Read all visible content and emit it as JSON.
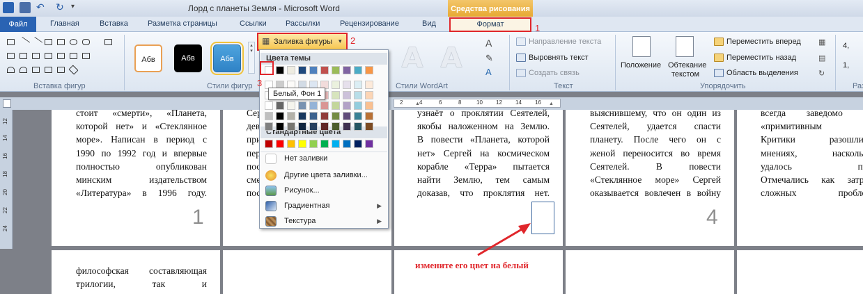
{
  "window": {
    "title": "Лорд с планеты Земля - Microsoft Word",
    "context_header": "Средства рисования"
  },
  "tabs": [
    {
      "label": "Файл"
    },
    {
      "label": "Главная"
    },
    {
      "label": "Вставка"
    },
    {
      "label": "Разметка страницы"
    },
    {
      "label": "Ссылки"
    },
    {
      "label": "Рассылки"
    },
    {
      "label": "Рецензирование"
    },
    {
      "label": "Вид"
    },
    {
      "label": "Формат"
    }
  ],
  "ribbon": {
    "groups": {
      "insert_shapes": "Вставка фигур",
      "shape_styles": "Стили фигур",
      "wordart_styles": "Стили WordArt",
      "text": "Текст",
      "arrange": "Упорядочить",
      "size_partial": "Разм"
    },
    "style_samples": [
      "Абв",
      "Абв",
      "Абв"
    ],
    "fill_button": "Заливка фигуры",
    "text_commands": {
      "direction": "Направление текста",
      "align": "Выровнять текст",
      "link": "Создать связь"
    },
    "arrange_commands": {
      "position": "Положение",
      "wrap_line1": "Обтекание",
      "wrap_line2": "текстом",
      "bring_forward": "Переместить вперед",
      "send_backward": "Переместить назад",
      "selection_pane": "Область выделения"
    },
    "size_partial": [
      "4,",
      "1,"
    ]
  },
  "dropdown": {
    "theme_colors_header": "Цвета темы",
    "standard_colors_header": "Стандартные цвета",
    "tooltip": "Белый, Фон 1",
    "theme_row": [
      "#ffffff",
      "#000000",
      "#eeece1",
      "#1f497d",
      "#4f81bd",
      "#c0504d",
      "#9bbb59",
      "#8064a2",
      "#4bacc6",
      "#f79646"
    ],
    "standard_row": [
      "#c00000",
      "#ff0000",
      "#ffc000",
      "#ffff00",
      "#92d050",
      "#00b050",
      "#00b0f0",
      "#0070c0",
      "#002060",
      "#7030a0"
    ],
    "items": {
      "no_fill": "Нет заливки",
      "more_colors": "Другие цвета заливки...",
      "picture": "Рисунок...",
      "gradient": "Градиентная",
      "texture": "Текстура"
    }
  },
  "annotations": {
    "marker1": "1",
    "marker2": "2",
    "marker3": "3",
    "instruction": "измените его цвет на белый"
  },
  "ruler": {
    "h_ticks": [
      "2",
      "4",
      "6",
      "8",
      "10",
      "12",
      "14",
      "16"
    ],
    "v_ticks": [
      "12",
      "14",
      "16",
      "18",
      "20",
      "22",
      "24"
    ]
  },
  "pages": {
    "p1_lines": [
      "стоит «смерти», «Планета,",
      "которой нет» и «Стеклянное",
      "море». Написан в период с",
      "1990 по 1992 год и впервые",
      "полностью опубликован",
      "минским издательством",
      "«Литература» в 1996 году."
    ],
    "p1_number": "1",
    "p2_lines": [
      "Сер",
      "дев",
      "при",
      "пер",
      "пос",
      "сме",
      "пос"
    ],
    "p3_lines": [
      "узнаёт о проклятии Сеятелей,",
      "якобы наложенном на Землю.",
      "В повести «Планета, которой",
      "нет» Сергей на космическом",
      "корабле «Терра» пытается",
      "найти Землю, тем самым",
      "доказав, что проклятия нет."
    ],
    "p4_lines": [
      "выяснившему, что он один из",
      "Сеятелей, удается спасти",
      "планету. После чего он с",
      "женой переносится во время",
      "Сеятелей. В повести",
      "«Стеклянное море» Сергей",
      "оказывается вовлечен в войну"
    ],
    "p4_number": "4",
    "p5_lines": [
      "всегда заведомо яв",
      "«примитивным чт",
      "Критики разошлись",
      "мнениях, насколько",
      "удалось пис",
      "Отмечались как затраг",
      "сложных проблем"
    ],
    "p6_lines": [
      "философская составляющая",
      "трилогии, так и"
    ]
  }
}
